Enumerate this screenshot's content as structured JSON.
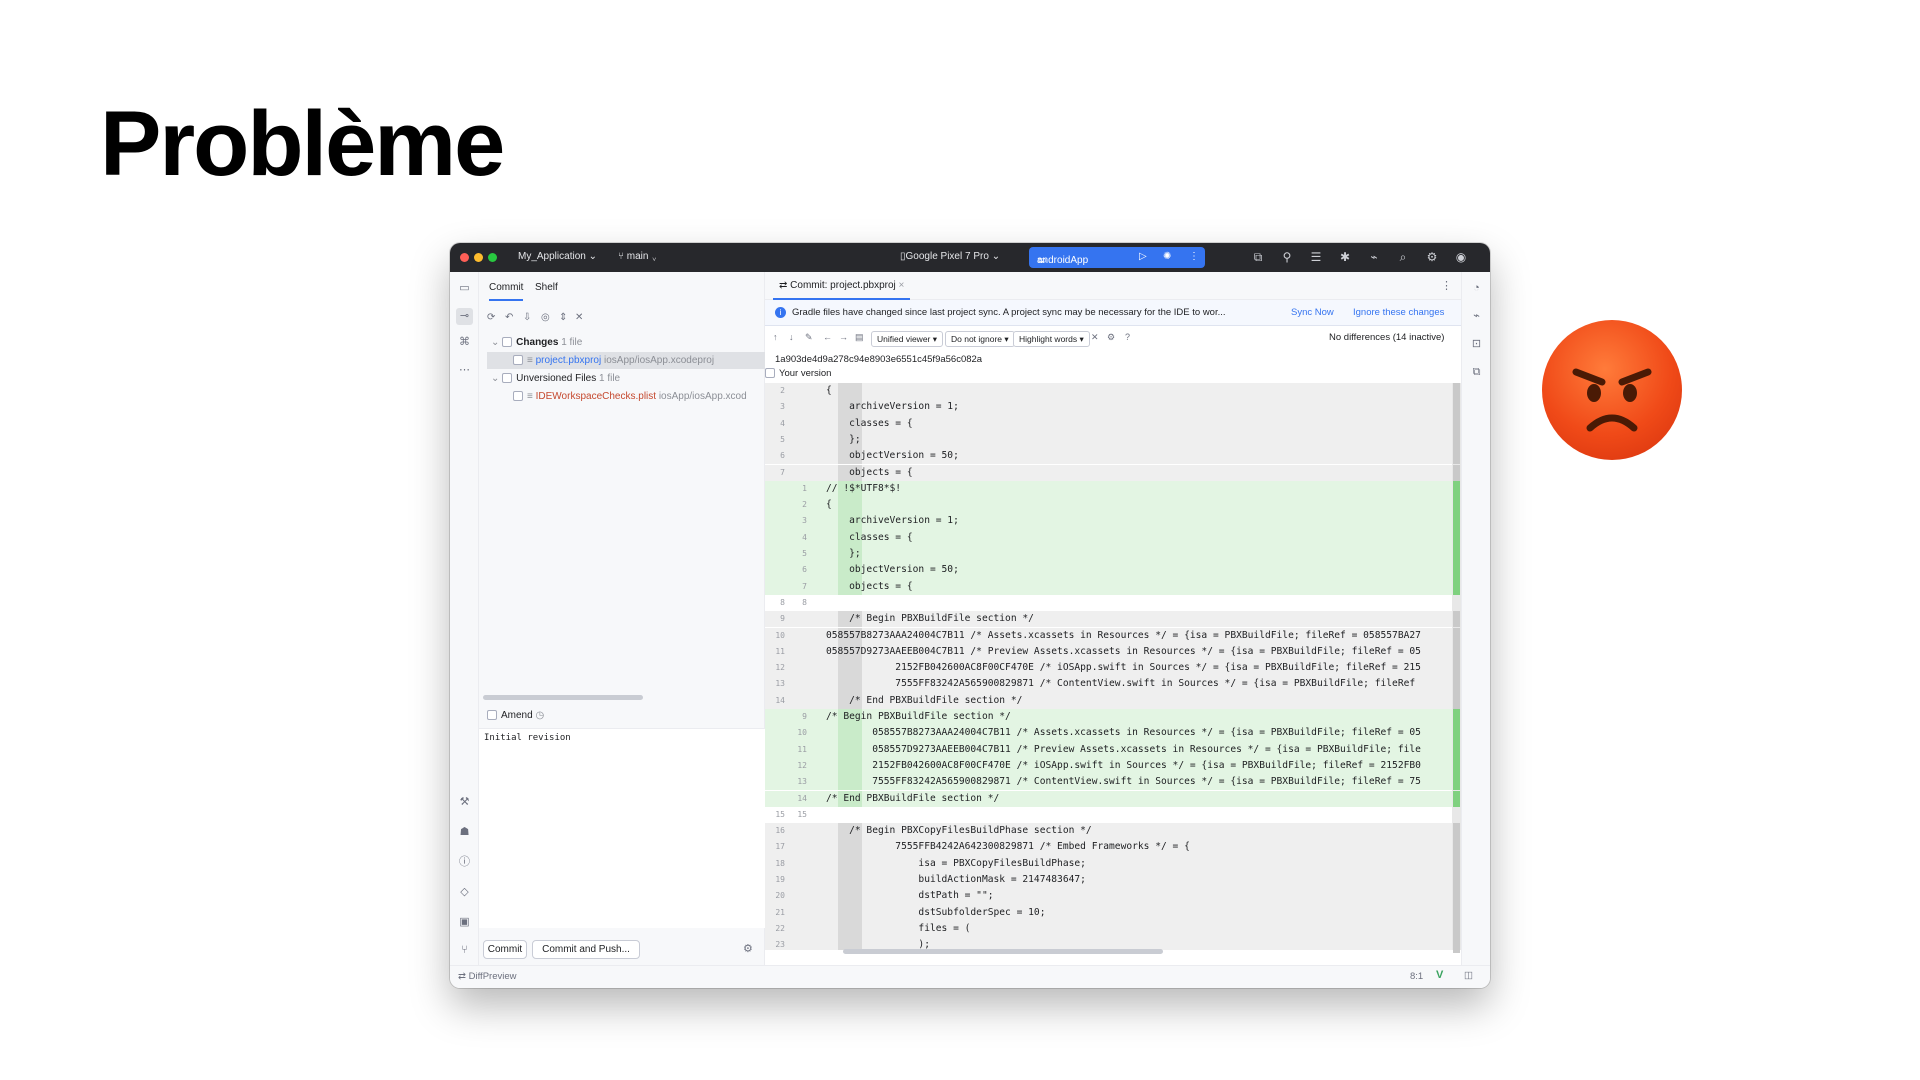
{
  "slide": {
    "title": "Problème"
  },
  "colors": {
    "accent": "#3574f0",
    "titlebar_bg": "#27282c",
    "added_bg": "#e3f5e3",
    "emoji": "#f04a18"
  },
  "titlebar": {
    "project": "My_Application",
    "branch": "main",
    "device": "Google Pixel 7 Pro",
    "run_config": "androidApp",
    "icons": [
      "vcs-icon",
      "translate-icon",
      "layout-icon",
      "bug-icon",
      "device-icon",
      "search-icon",
      "settings-icon",
      "account-icon"
    ]
  },
  "commit_panel": {
    "tabs": [
      "Commit",
      "Shelf"
    ],
    "changes_label": "Changes",
    "changes_count": "1 file",
    "changed_file": "project.pbxproj",
    "changed_file_path": "iosApp/iosApp.xcodeproj",
    "unversioned_label": "Unversioned Files",
    "unversioned_count": "1 file",
    "unversioned_file": "IDEWorkspaceChecks.plist",
    "unversioned_path": "iosApp/iosApp.xcod",
    "amend_label": "Amend",
    "message": "Initial revision",
    "commit_button": "Commit",
    "commit_push_button": "Commit and Push..."
  },
  "diff": {
    "tab_title": "Commit: project.pbxproj",
    "banner_text": "Gradle files have changed since last project sync. A project sync may be necessary for the IDE to wor...",
    "sync_now": "Sync Now",
    "ignore_changes": "Ignore these changes",
    "viewer": "Unified viewer",
    "ignore_mode": "Do not ignore",
    "highlight": "Highlight words",
    "help": "?",
    "status": "No differences (14 inactive)",
    "hash": "1a903de4d9a278c94e8903e6551c45f9a56c082a",
    "your_version": "Your version",
    "lines": [
      {
        "k": "grey",
        "l": "2",
        "r": "",
        "t": "{"
      },
      {
        "k": "grey",
        "l": "3",
        "r": "",
        "t": "    archiveVersion = 1;"
      },
      {
        "k": "grey",
        "l": "4",
        "r": "",
        "t": "    classes = {"
      },
      {
        "k": "grey",
        "l": "5",
        "r": "",
        "t": "    };"
      },
      {
        "k": "grey",
        "l": "6",
        "r": "",
        "t": "    objectVersion = 50;"
      },
      {
        "k": "grey",
        "l": "7",
        "r": "",
        "t": "    objects = {"
      },
      {
        "k": "green",
        "l": "",
        "r": "1",
        "t": "// !$*UTF8*$!"
      },
      {
        "k": "green",
        "l": "",
        "r": "2",
        "t": "{"
      },
      {
        "k": "green",
        "l": "",
        "r": "3",
        "t": "    archiveVersion = 1;"
      },
      {
        "k": "green",
        "l": "",
        "r": "4",
        "t": "    classes = {"
      },
      {
        "k": "green",
        "l": "",
        "r": "5",
        "t": "    };"
      },
      {
        "k": "green",
        "l": "",
        "r": "6",
        "t": "    objectVersion = 50;"
      },
      {
        "k": "green",
        "l": "",
        "r": "7",
        "t": "    objects = {"
      },
      {
        "k": "plain",
        "l": "8",
        "r": "8",
        "t": ""
      },
      {
        "k": "grey",
        "l": "9",
        "r": "",
        "t": "    /* Begin PBXBuildFile section */"
      },
      {
        "k": "grey",
        "l": "10",
        "r": "",
        "t": "058557B8273AAA24004C7B11 /* Assets.xcassets in Resources */ = {isa = PBXBuildFile; fileRef = 058557BA27"
      },
      {
        "k": "grey",
        "l": "11",
        "r": "",
        "t": "058557D9273AAEEB004C7B11 /* Preview Assets.xcassets in Resources */ = {isa = PBXBuildFile; fileRef = 05"
      },
      {
        "k": "grey",
        "l": "12",
        "r": "",
        "t": "            2152FB042600AC8F00CF470E /* iOSApp.swift in Sources */ = {isa = PBXBuildFile; fileRef = 215"
      },
      {
        "k": "grey",
        "l": "13",
        "r": "",
        "t": "            7555FF83242A565900829871 /* ContentView.swift in Sources */ = {isa = PBXBuildFile; fileRef"
      },
      {
        "k": "grey",
        "l": "14",
        "r": "",
        "t": "    /* End PBXBuildFile section */"
      },
      {
        "k": "green",
        "l": "",
        "r": "9",
        "t": "/* Begin PBXBuildFile section */"
      },
      {
        "k": "green",
        "l": "",
        "r": "10",
        "t": "        058557B8273AAA24004C7B11 /* Assets.xcassets in Resources */ = {isa = PBXBuildFile; fileRef = 05"
      },
      {
        "k": "green",
        "l": "",
        "r": "11",
        "t": "        058557D9273AAEEB004C7B11 /* Preview Assets.xcassets in Resources */ = {isa = PBXBuildFile; file"
      },
      {
        "k": "green",
        "l": "",
        "r": "12",
        "t": "        2152FB042600AC8F00CF470E /* iOSApp.swift in Sources */ = {isa = PBXBuildFile; fileRef = 2152FB0"
      },
      {
        "k": "green",
        "l": "",
        "r": "13",
        "t": "        7555FF83242A565900829871 /* ContentView.swift in Sources */ = {isa = PBXBuildFile; fileRef = 75"
      },
      {
        "k": "green",
        "l": "",
        "r": "14",
        "t": "/* End PBXBuildFile section */"
      },
      {
        "k": "plain",
        "l": "15",
        "r": "15",
        "t": ""
      },
      {
        "k": "grey",
        "l": "16",
        "r": "",
        "t": "    /* Begin PBXCopyFilesBuildPhase section */"
      },
      {
        "k": "grey",
        "l": "17",
        "r": "",
        "t": "            7555FFB4242A642300829871 /* Embed Frameworks */ = {"
      },
      {
        "k": "grey",
        "l": "18",
        "r": "",
        "t": "                isa = PBXCopyFilesBuildPhase;"
      },
      {
        "k": "grey",
        "l": "19",
        "r": "",
        "t": "                buildActionMask = 2147483647;"
      },
      {
        "k": "grey",
        "l": "20",
        "r": "",
        "t": "                dstPath = \"\";"
      },
      {
        "k": "grey",
        "l": "21",
        "r": "",
        "t": "                dstSubfolderSpec = 10;"
      },
      {
        "k": "grey",
        "l": "22",
        "r": "",
        "t": "                files = ("
      },
      {
        "k": "grey",
        "l": "23",
        "r": "",
        "t": "                );"
      }
    ]
  },
  "statusbar": {
    "left": "DiffPreview",
    "position": "8:1"
  }
}
